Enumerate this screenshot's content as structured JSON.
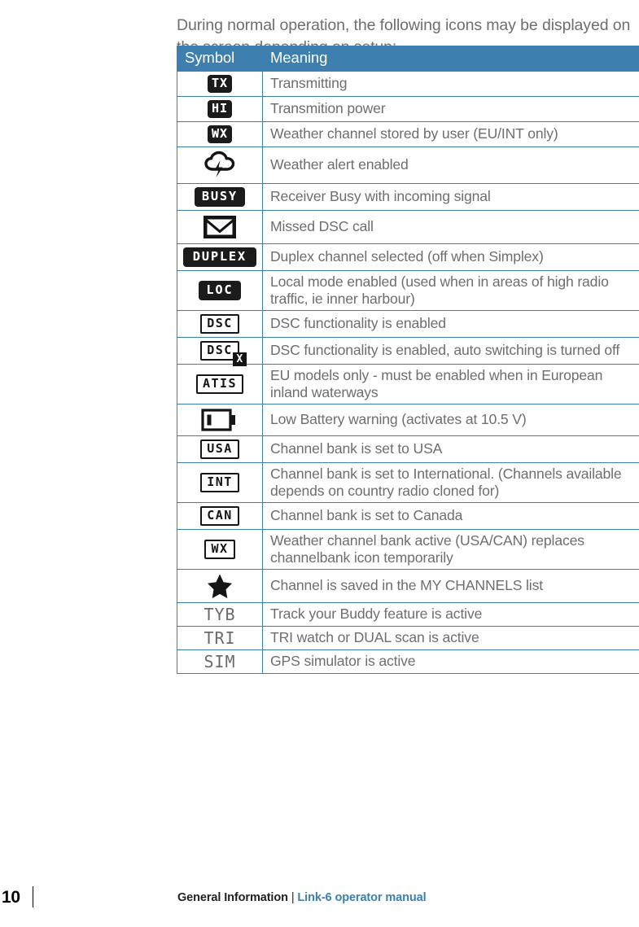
{
  "intro": "During normal operation, the following icons may be displayed on the screen depending on setup:",
  "table": {
    "headers": {
      "symbol": "Symbol",
      "meaning": "Meaning"
    },
    "rows": [
      {
        "icon_name": "tx-icon",
        "icon_text": "TX",
        "icon_style": "inverted-slab",
        "meaning": "Transmitting"
      },
      {
        "icon_name": "hi-power-icon",
        "icon_text": "HI",
        "icon_style": "inverted-slab",
        "meaning": "Transmition power"
      },
      {
        "icon_name": "wx-stored-icon",
        "icon_text": "WX",
        "icon_style": "inverted-slab",
        "meaning": "Weather channel stored by user (EU/INT only)"
      },
      {
        "icon_name": "weather-alert-cloud-icon",
        "icon_text": "",
        "icon_style": "cloud-lightning",
        "meaning": "Weather alert enabled"
      },
      {
        "icon_name": "busy-icon",
        "icon_text": "BUSY",
        "icon_style": "inverted-slab",
        "meaning": "Receiver Busy with incoming signal"
      },
      {
        "icon_name": "envelope-icon",
        "icon_text": "",
        "icon_style": "envelope",
        "meaning": "Missed DSC call"
      },
      {
        "icon_name": "duplex-icon",
        "icon_text": "DUPLEX",
        "icon_style": "inverted-slab",
        "meaning": "Duplex channel selected (off when Simplex)"
      },
      {
        "icon_name": "loc-icon",
        "icon_text": "LOC",
        "icon_style": "inverted-slab",
        "meaning": "Local mode enabled (used when in areas of high radio traffic, ie inner harbour)"
      },
      {
        "icon_name": "dsc-icon",
        "icon_text": "DSC",
        "icon_style": "outlined-box",
        "meaning": "DSC functionality is enabled"
      },
      {
        "icon_name": "dsc-no-autoswitch-icon",
        "icon_text": "DSC",
        "icon_badge": "X",
        "icon_style": "outlined-box-with-x",
        "meaning": "DSC functionality is enabled, auto switching is turned off"
      },
      {
        "icon_name": "atis-icon",
        "icon_text": "ATIS",
        "icon_style": "outlined-box",
        "meaning": "EU models only - must be enabled when in European inland waterways"
      },
      {
        "icon_name": "low-battery-icon",
        "icon_text": "",
        "icon_style": "battery",
        "meaning": "Low Battery warning (activates at 10.5 V)"
      },
      {
        "icon_name": "usa-bank-icon",
        "icon_text": "USA",
        "icon_style": "outlined-box",
        "meaning": "Channel bank is set to USA"
      },
      {
        "icon_name": "int-bank-icon",
        "icon_text": "INT",
        "icon_style": "outlined-box",
        "meaning": "Channel bank is set to International. (Channels available depends on country radio cloned for)"
      },
      {
        "icon_name": "can-bank-icon",
        "icon_text": "CAN",
        "icon_style": "outlined-box",
        "meaning": "Channel bank is set to Canada"
      },
      {
        "icon_name": "wx-bank-icon",
        "icon_text": "WX",
        "icon_style": "outlined-box",
        "meaning": "Weather channel bank active (USA/CAN) replaces channelbank icon temporarily"
      },
      {
        "icon_name": "star-icon",
        "icon_text": "",
        "icon_style": "star",
        "meaning": "Channel is saved in the MY CHANNELS list"
      },
      {
        "icon_name": "tyb-icon",
        "icon_text": "TYB",
        "icon_style": "plain-lcd",
        "meaning": "Track your Buddy feature is active"
      },
      {
        "icon_name": "tri-icon",
        "icon_text": "TRI",
        "icon_style": "plain-lcd",
        "meaning": "TRI watch or DUAL scan is active"
      },
      {
        "icon_name": "sim-icon",
        "icon_text": "SIM",
        "icon_style": "plain-lcd",
        "meaning": "GPS simulator is active"
      }
    ]
  },
  "footer": {
    "page_number": "10",
    "section": "General Information",
    "separator": "|",
    "document": "Link-6 operator manual"
  },
  "colors": {
    "header_blue": "#3d7fae",
    "body_text": "#6d6e71",
    "icon_black": "#1b1b1b",
    "link_blue": "#3d7fae"
  }
}
